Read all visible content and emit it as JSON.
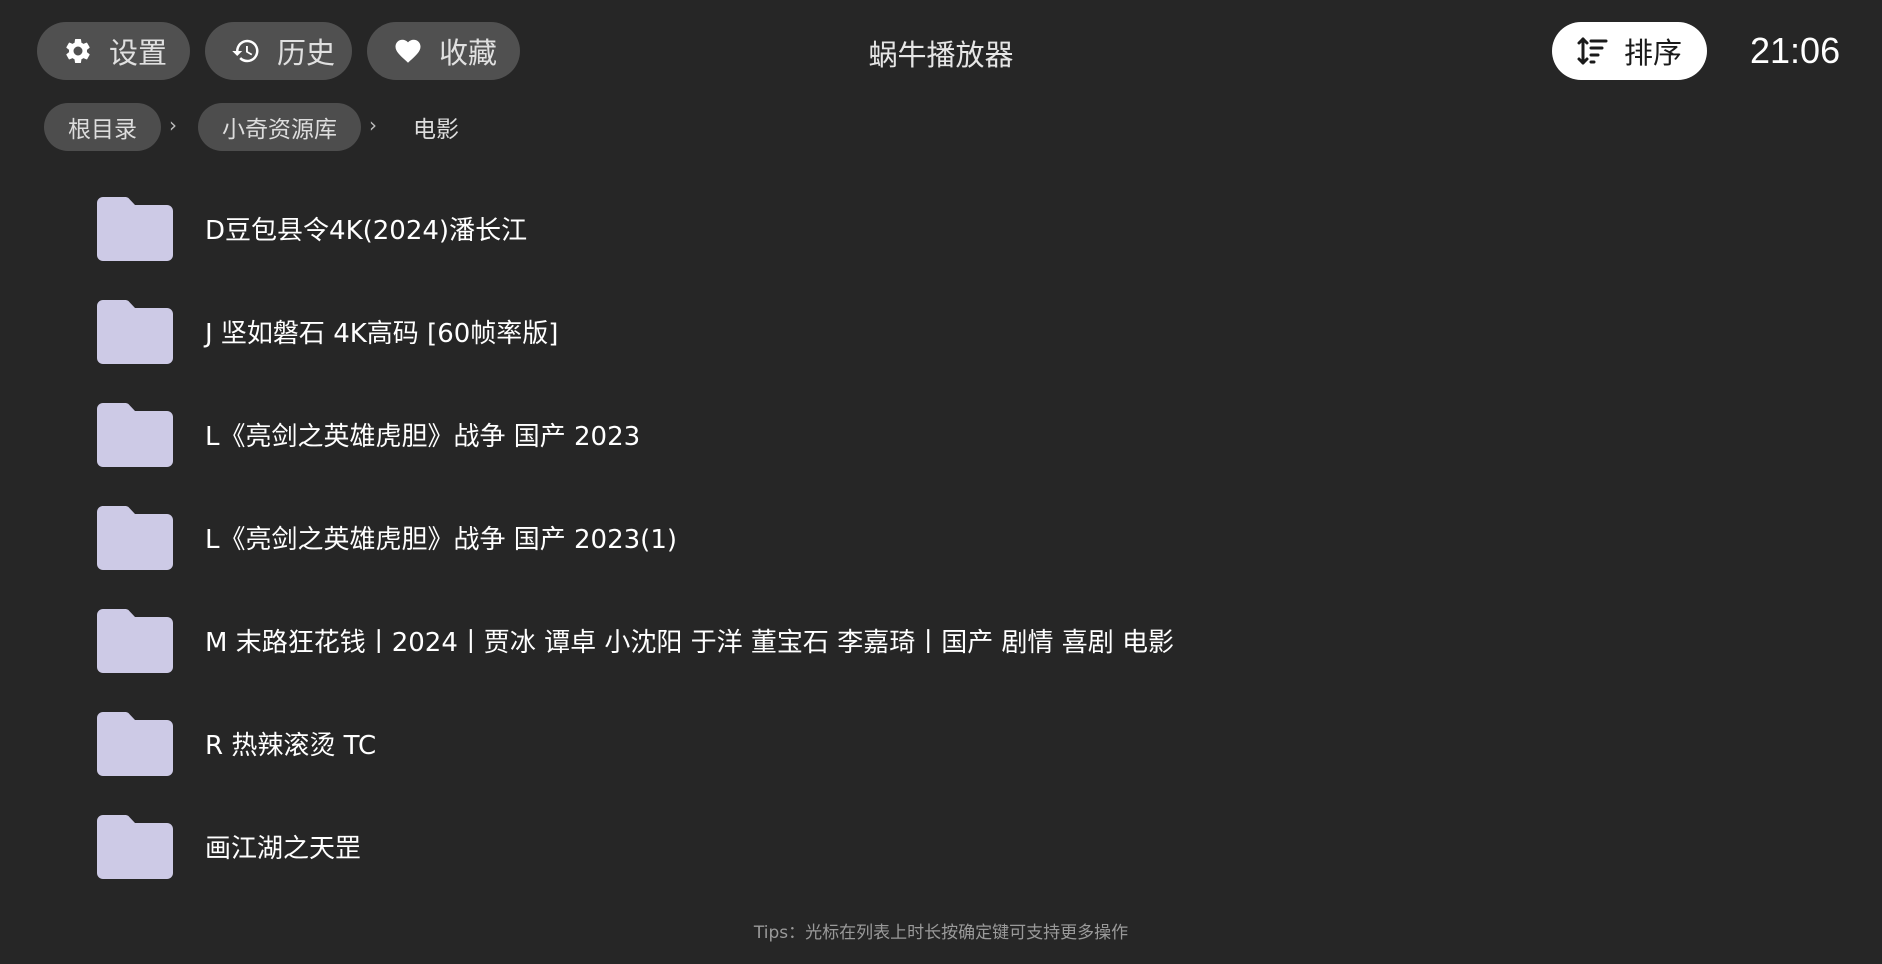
{
  "app": {
    "title": "蜗牛播放器",
    "clock": "21:06"
  },
  "toolbar": {
    "settings_label": "设置",
    "history_label": "历史",
    "favorites_label": "收藏",
    "sort_label": "排序"
  },
  "breadcrumb": {
    "items": [
      "根目录",
      "小奇资源库"
    ],
    "separator": "›",
    "current": "电影"
  },
  "folders": [
    {
      "name": "D豆包县令4K(2024)潘长江",
      "icon": "folder-icon"
    },
    {
      "name": "J 坚如磐石 4K高码 [60帧率版]",
      "icon": "folder-icon"
    },
    {
      "name": "L《亮剑之英雄虎胆》战争 国产 2023",
      "icon": "folder-icon"
    },
    {
      "name": "L《亮剑之英雄虎胆》战争 国产 2023(1)",
      "icon": "folder-icon"
    },
    {
      "name": "M 末路狂花钱丨2024丨贾冰 谭卓 小沈阳 于洋 董宝石 李嘉琦丨国产 剧情 喜剧 电影",
      "icon": "folder-icon"
    },
    {
      "name": "R 热辣滚烫 TC",
      "icon": "folder-icon"
    },
    {
      "name": "画江湖之天罡",
      "icon": "folder-icon"
    }
  ],
  "tips": "Tips：光标在列表上时长按确定键可支持更多操作",
  "colors": {
    "background": "#262626",
    "button_bg": "#505050",
    "sort_button_bg": "#ffffff",
    "folder": "#cdcae6",
    "tips_text": "#9a9a9a"
  }
}
